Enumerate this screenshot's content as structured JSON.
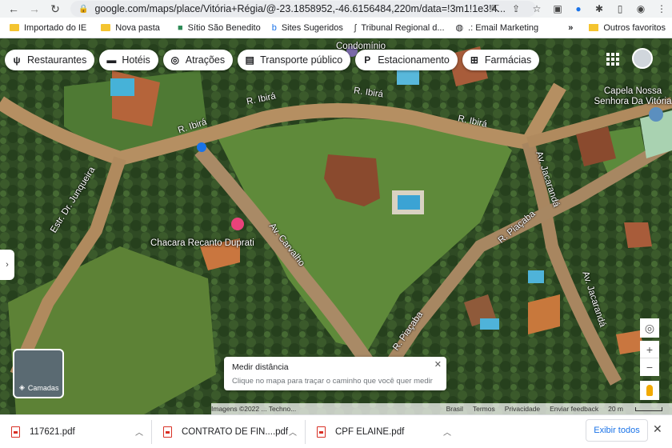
{
  "browser": {
    "url": "google.com/maps/place/Vitória+Régia/@-23.1858952,-46.6156484,220m/data=!3m1!1e3!4...",
    "back_icon": "arrow-left-icon",
    "forward_icon": "arrow-right-icon",
    "reload_icon": "reload-icon"
  },
  "bookmarks": {
    "items": [
      {
        "label": "Importado do IE",
        "icon": "folder-icon"
      },
      {
        "label": "Nova pasta",
        "icon": "folder-icon"
      },
      {
        "label": "Sítio São Benedito",
        "icon": "site-icon"
      },
      {
        "label": "Sites Sugeridos",
        "icon": "site-icon"
      },
      {
        "label": "Tribunal Regional d...",
        "icon": "site-icon"
      },
      {
        "label": ".: Email Marketing",
        "icon": "globe-icon"
      }
    ],
    "more": "»",
    "other": "Outros favoritos"
  },
  "map": {
    "chips": [
      {
        "label": "Restaurantes",
        "icon": "fork-knife-icon"
      },
      {
        "label": "Hotéis",
        "icon": "bed-icon"
      },
      {
        "label": "Atrações",
        "icon": "camera-icon"
      },
      {
        "label": "Transporte público",
        "icon": "bus-icon"
      },
      {
        "label": "Estacionamento",
        "icon": "parking-icon"
      },
      {
        "label": "Farmácias",
        "icon": "pharmacy-icon"
      }
    ],
    "labels": {
      "r_ibira_1": "R. Ibirá",
      "r_ibira_2": "R. Ibirá",
      "r_ibira_3": "R. Ibirá",
      "r_ibira_4": "R. Ibirá",
      "estr_junqueira": "Estr. Dr. Junqueira",
      "av_carvalho": "Av. Carvalho",
      "r_placaba_1": "R. Piaçaba",
      "r_placaba_2": "R. Piaçaba",
      "av_jacaranda_1": "Av. Jacarandá",
      "av_jacaranda_2": "Av. Jacarandá",
      "condominio": "Condomínio",
      "capela": "Capela Nossa Senhora Da Vitória",
      "chacara": "Chacara Recanto Duprati"
    },
    "layers_label": "Camadas",
    "measure": {
      "title": "Medir distância",
      "hint": "Clique no mapa para traçar o caminho que você quer medir"
    },
    "attribution": {
      "imagery": "Imagens ©2022 ... Techno...",
      "year": "2022",
      "country": "Brasil",
      "terms": "Termos",
      "privacy": "Privacidade",
      "feedback": "Enviar feedback",
      "scale": "20 m"
    }
  },
  "downloads": {
    "items": [
      {
        "name": "117621.pdf"
      },
      {
        "name": "CONTRATO DE FIN....pdf"
      },
      {
        "name": "CPF ELAINE.pdf"
      }
    ],
    "show_all": "Exibir todos"
  }
}
